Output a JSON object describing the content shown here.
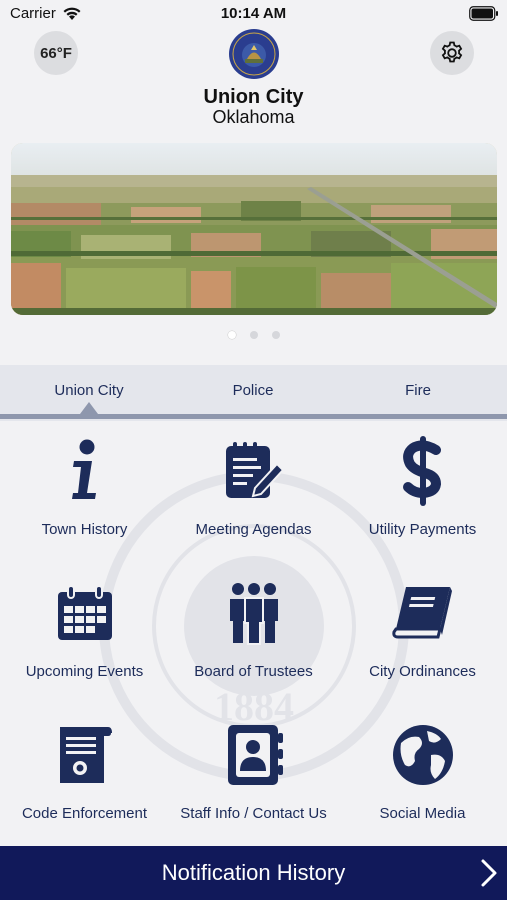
{
  "status_bar": {
    "carrier": "Carrier",
    "time": "10:14 AM"
  },
  "header": {
    "temperature": "66°F",
    "city": "Union City",
    "state": "Oklahoma"
  },
  "seal": {
    "line_top": "GREAT SEAL OF",
    "line_bottom": "UNION CITY",
    "year": "1884"
  },
  "tabs": [
    {
      "label": "Union City",
      "selected": true
    },
    {
      "label": "Police",
      "selected": false
    },
    {
      "label": "Fire",
      "selected": false
    }
  ],
  "grid": {
    "tiles": [
      {
        "label": "Town History",
        "icon": "info-icon"
      },
      {
        "label": "Meeting Agendas",
        "icon": "agenda-icon"
      },
      {
        "label": "Utility Payments",
        "icon": "dollar-icon"
      },
      {
        "label": "Upcoming Events",
        "icon": "calendar-icon"
      },
      {
        "label": "Board of Trustees",
        "icon": "group-icon"
      },
      {
        "label": "City Ordinances",
        "icon": "book-icon"
      },
      {
        "label": "Code Enforcement",
        "icon": "certificate-icon"
      },
      {
        "label": "Staff Info / Contact Us",
        "icon": "contact-book-icon"
      },
      {
        "label": "Social Media",
        "icon": "globe-icon"
      }
    ]
  },
  "banner": {
    "page_count": 3,
    "current_page": 1
  },
  "footer": {
    "notification_label": "Notification History"
  },
  "colors": {
    "accent": "#1d2c5a",
    "footer": "#11195a",
    "tab_bar": "#e4e6ec"
  }
}
